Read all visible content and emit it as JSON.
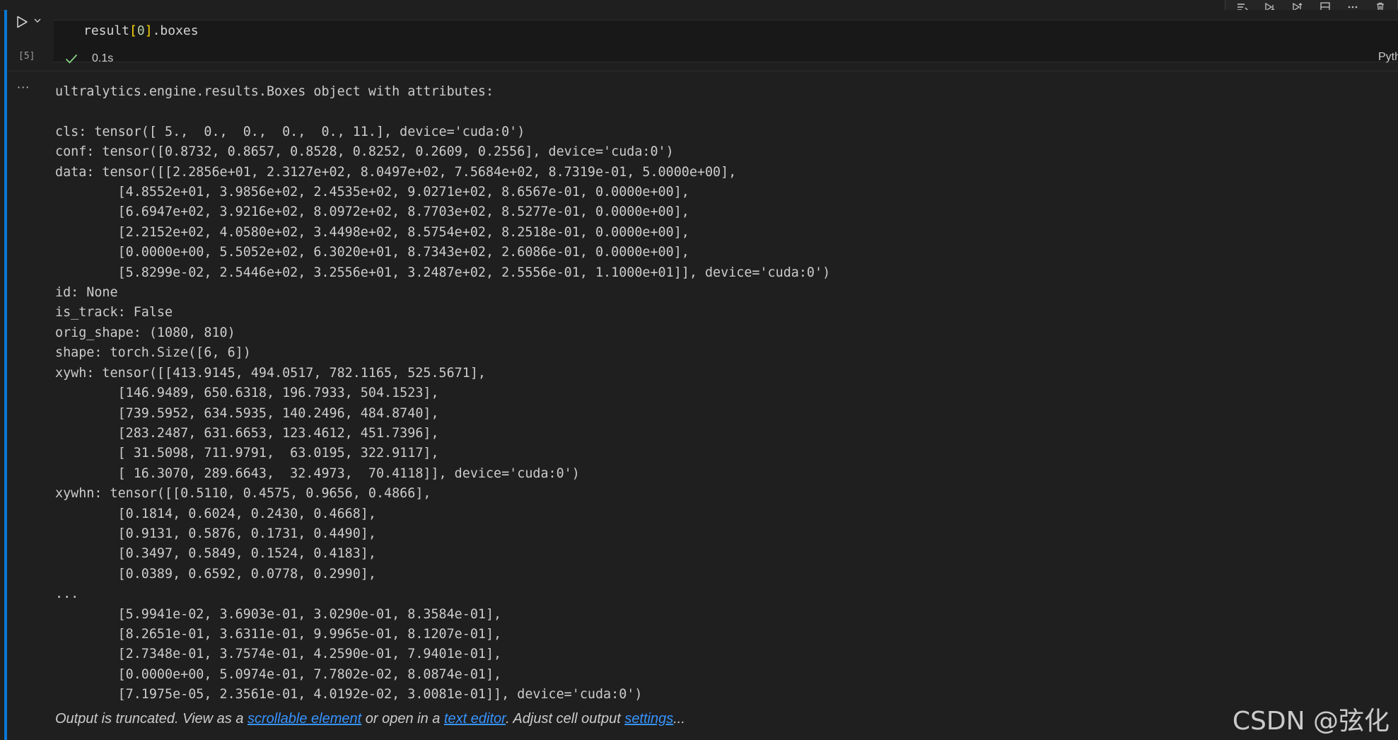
{
  "toolbar": {
    "icons": [
      "execute-above-icon",
      "execute-below-icon",
      "execute-cell-and-below-icon",
      "split-cell-icon",
      "more-icon",
      "delete-icon"
    ]
  },
  "input_cell": {
    "execution_count": "[5]",
    "code_prefix": "result",
    "code_open_bracket": "[",
    "code_index": "0",
    "code_close_bracket": "]",
    "code_suffix": ".boxes",
    "exec_time": "0.1s",
    "kernel_label": "Pyth"
  },
  "output": {
    "more_label": "···",
    "lines": [
      "ultralytics.engine.results.Boxes object with attributes:",
      "",
      "cls: tensor([ 5.,  0.,  0.,  0.,  0., 11.], device='cuda:0')",
      "conf: tensor([0.8732, 0.8657, 0.8528, 0.8252, 0.2609, 0.2556], device='cuda:0')",
      "data: tensor([[2.2856e+01, 2.3127e+02, 8.0497e+02, 7.5684e+02, 8.7319e-01, 5.0000e+00],",
      "        [4.8552e+01, 3.9856e+02, 2.4535e+02, 9.0271e+02, 8.6567e-01, 0.0000e+00],",
      "        [6.6947e+02, 3.9216e+02, 8.0972e+02, 8.7703e+02, 8.5277e-01, 0.0000e+00],",
      "        [2.2152e+02, 4.0580e+02, 3.4498e+02, 8.5754e+02, 8.2518e-01, 0.0000e+00],",
      "        [0.0000e+00, 5.5052e+02, 6.3020e+01, 8.7343e+02, 2.6086e-01, 0.0000e+00],",
      "        [5.8299e-02, 2.5446e+02, 3.2556e+01, 3.2487e+02, 2.5556e-01, 1.1000e+01]], device='cuda:0')",
      "id: None",
      "is_track: False",
      "orig_shape: (1080, 810)",
      "shape: torch.Size([6, 6])",
      "xywh: tensor([[413.9145, 494.0517, 782.1165, 525.5671],",
      "        [146.9489, 650.6318, 196.7933, 504.1523],",
      "        [739.5952, 634.5935, 140.2496, 484.8740],",
      "        [283.2487, 631.6653, 123.4612, 451.7396],",
      "        [ 31.5098, 711.9791,  63.0195, 322.9117],",
      "        [ 16.3070, 289.6643,  32.4973,  70.4118]], device='cuda:0')",
      "xywhn: tensor([[0.5110, 0.4575, 0.9656, 0.4866],",
      "        [0.1814, 0.6024, 0.2430, 0.4668],",
      "        [0.9131, 0.5876, 0.1731, 0.4490],",
      "        [0.3497, 0.5849, 0.1524, 0.4183],",
      "        [0.0389, 0.6592, 0.0778, 0.2990],",
      "...",
      "        [5.9941e-02, 3.6903e-01, 3.0290e-01, 8.3584e-01],",
      "        [8.2651e-01, 3.6311e-01, 9.9965e-01, 8.1207e-01],",
      "        [2.7348e-01, 3.7574e-01, 4.2590e-01, 7.9401e-01],",
      "        [0.0000e+00, 5.0974e-01, 7.7802e-02, 8.0874e-01],",
      "        [7.1975e-05, 2.3561e-01, 4.0192e-02, 3.0081e-01]], device='cuda:0')"
    ],
    "truncation": {
      "text_1": "Output is truncated. View as a ",
      "link_1": "scrollable element",
      "text_2": " or open in a ",
      "link_2": "text editor",
      "text_3": ". Adjust cell output ",
      "link_3": "settings",
      "text_4": "..."
    }
  },
  "watermark": "CSDN @弦化",
  "colors": {
    "background": "#1f1f1f",
    "focus_bar": "#0a78d4",
    "link": "#3794ff",
    "success_check": "#89d185",
    "bracket": "#ffd700",
    "number": "#b5cea8"
  }
}
